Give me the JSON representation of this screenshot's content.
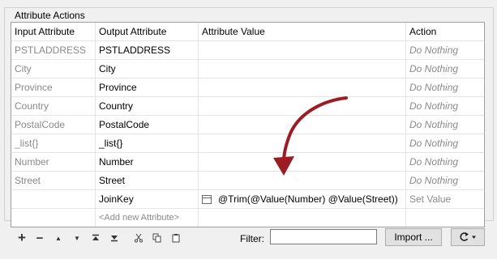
{
  "group_title": "Attribute Actions",
  "columns": [
    "Input Attribute",
    "Output Attribute",
    "Attribute Value",
    "Action"
  ],
  "rows": [
    {
      "input": "PSTLADDRESS",
      "output": "PSTLADDRESS",
      "value": "",
      "action": "Do Nothing"
    },
    {
      "input": "City",
      "output": "City",
      "value": "",
      "action": "Do Nothing"
    },
    {
      "input": "Province",
      "output": "Province",
      "value": "",
      "action": "Do Nothing"
    },
    {
      "input": "Country",
      "output": "Country",
      "value": "",
      "action": "Do Nothing"
    },
    {
      "input": "PostalCode",
      "output": "PostalCode",
      "value": "",
      "action": "Do Nothing"
    },
    {
      "input": "_list{}",
      "output": "_list{}",
      "value": "",
      "action": "Do Nothing"
    },
    {
      "input": "Number",
      "output": "Number",
      "value": "",
      "action": "Do Nothing"
    },
    {
      "input": "Street",
      "output": "Street",
      "value": "",
      "action": "Do Nothing"
    },
    {
      "input": "",
      "output": "JoinKey",
      "value": "@Trim(@Value(Number) @Value(Street))",
      "action": "Set Value"
    }
  ],
  "add_new_placeholder": "<Add new Attribute>",
  "toolbar": {
    "icons": [
      "add-icon",
      "remove-icon",
      "move-up-icon",
      "move-down-icon",
      "move-top-icon",
      "move-bottom-icon",
      "cut-icon",
      "copy-icon",
      "paste-icon"
    ],
    "filter_label": "Filter:",
    "filter_value": "",
    "import_label": "Import ...",
    "refresh_icon": "refresh-icon"
  },
  "colors": {
    "arrow": "#9b1c22",
    "dim_text": "#8a8a8a"
  }
}
